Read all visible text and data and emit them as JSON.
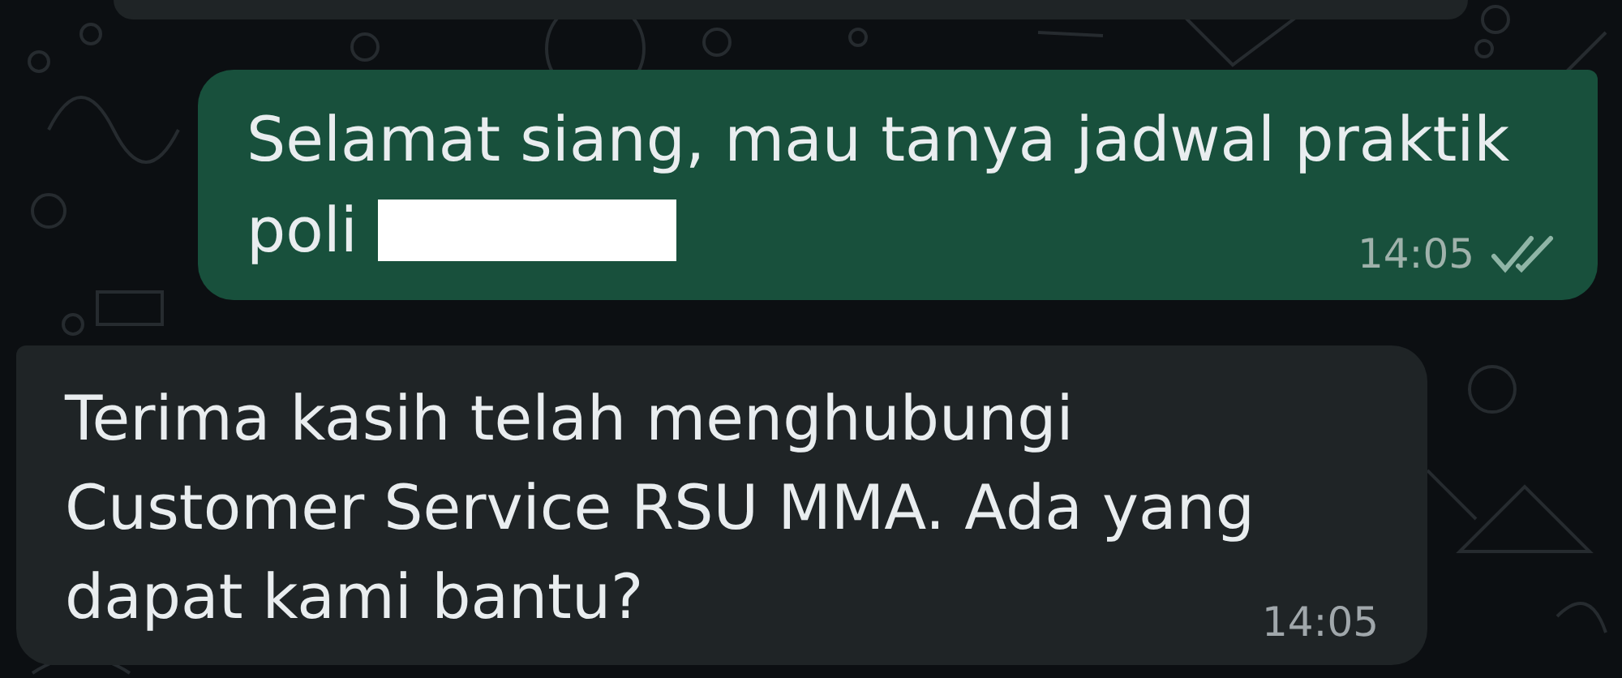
{
  "messages": [
    {
      "kind": "clipped"
    },
    {
      "kind": "outgoing",
      "lines": [
        "Selamat siang, mau tanya jadwal praktik",
        "poli"
      ],
      "redacted": true,
      "time": "14:05",
      "read": false
    },
    {
      "kind": "incoming",
      "lines": [
        "Terima kasih telah menghubungi",
        "Customer Service RSU MMA. Ada yang",
        "dapat kami bantu?"
      ],
      "time": "14:05"
    }
  ]
}
